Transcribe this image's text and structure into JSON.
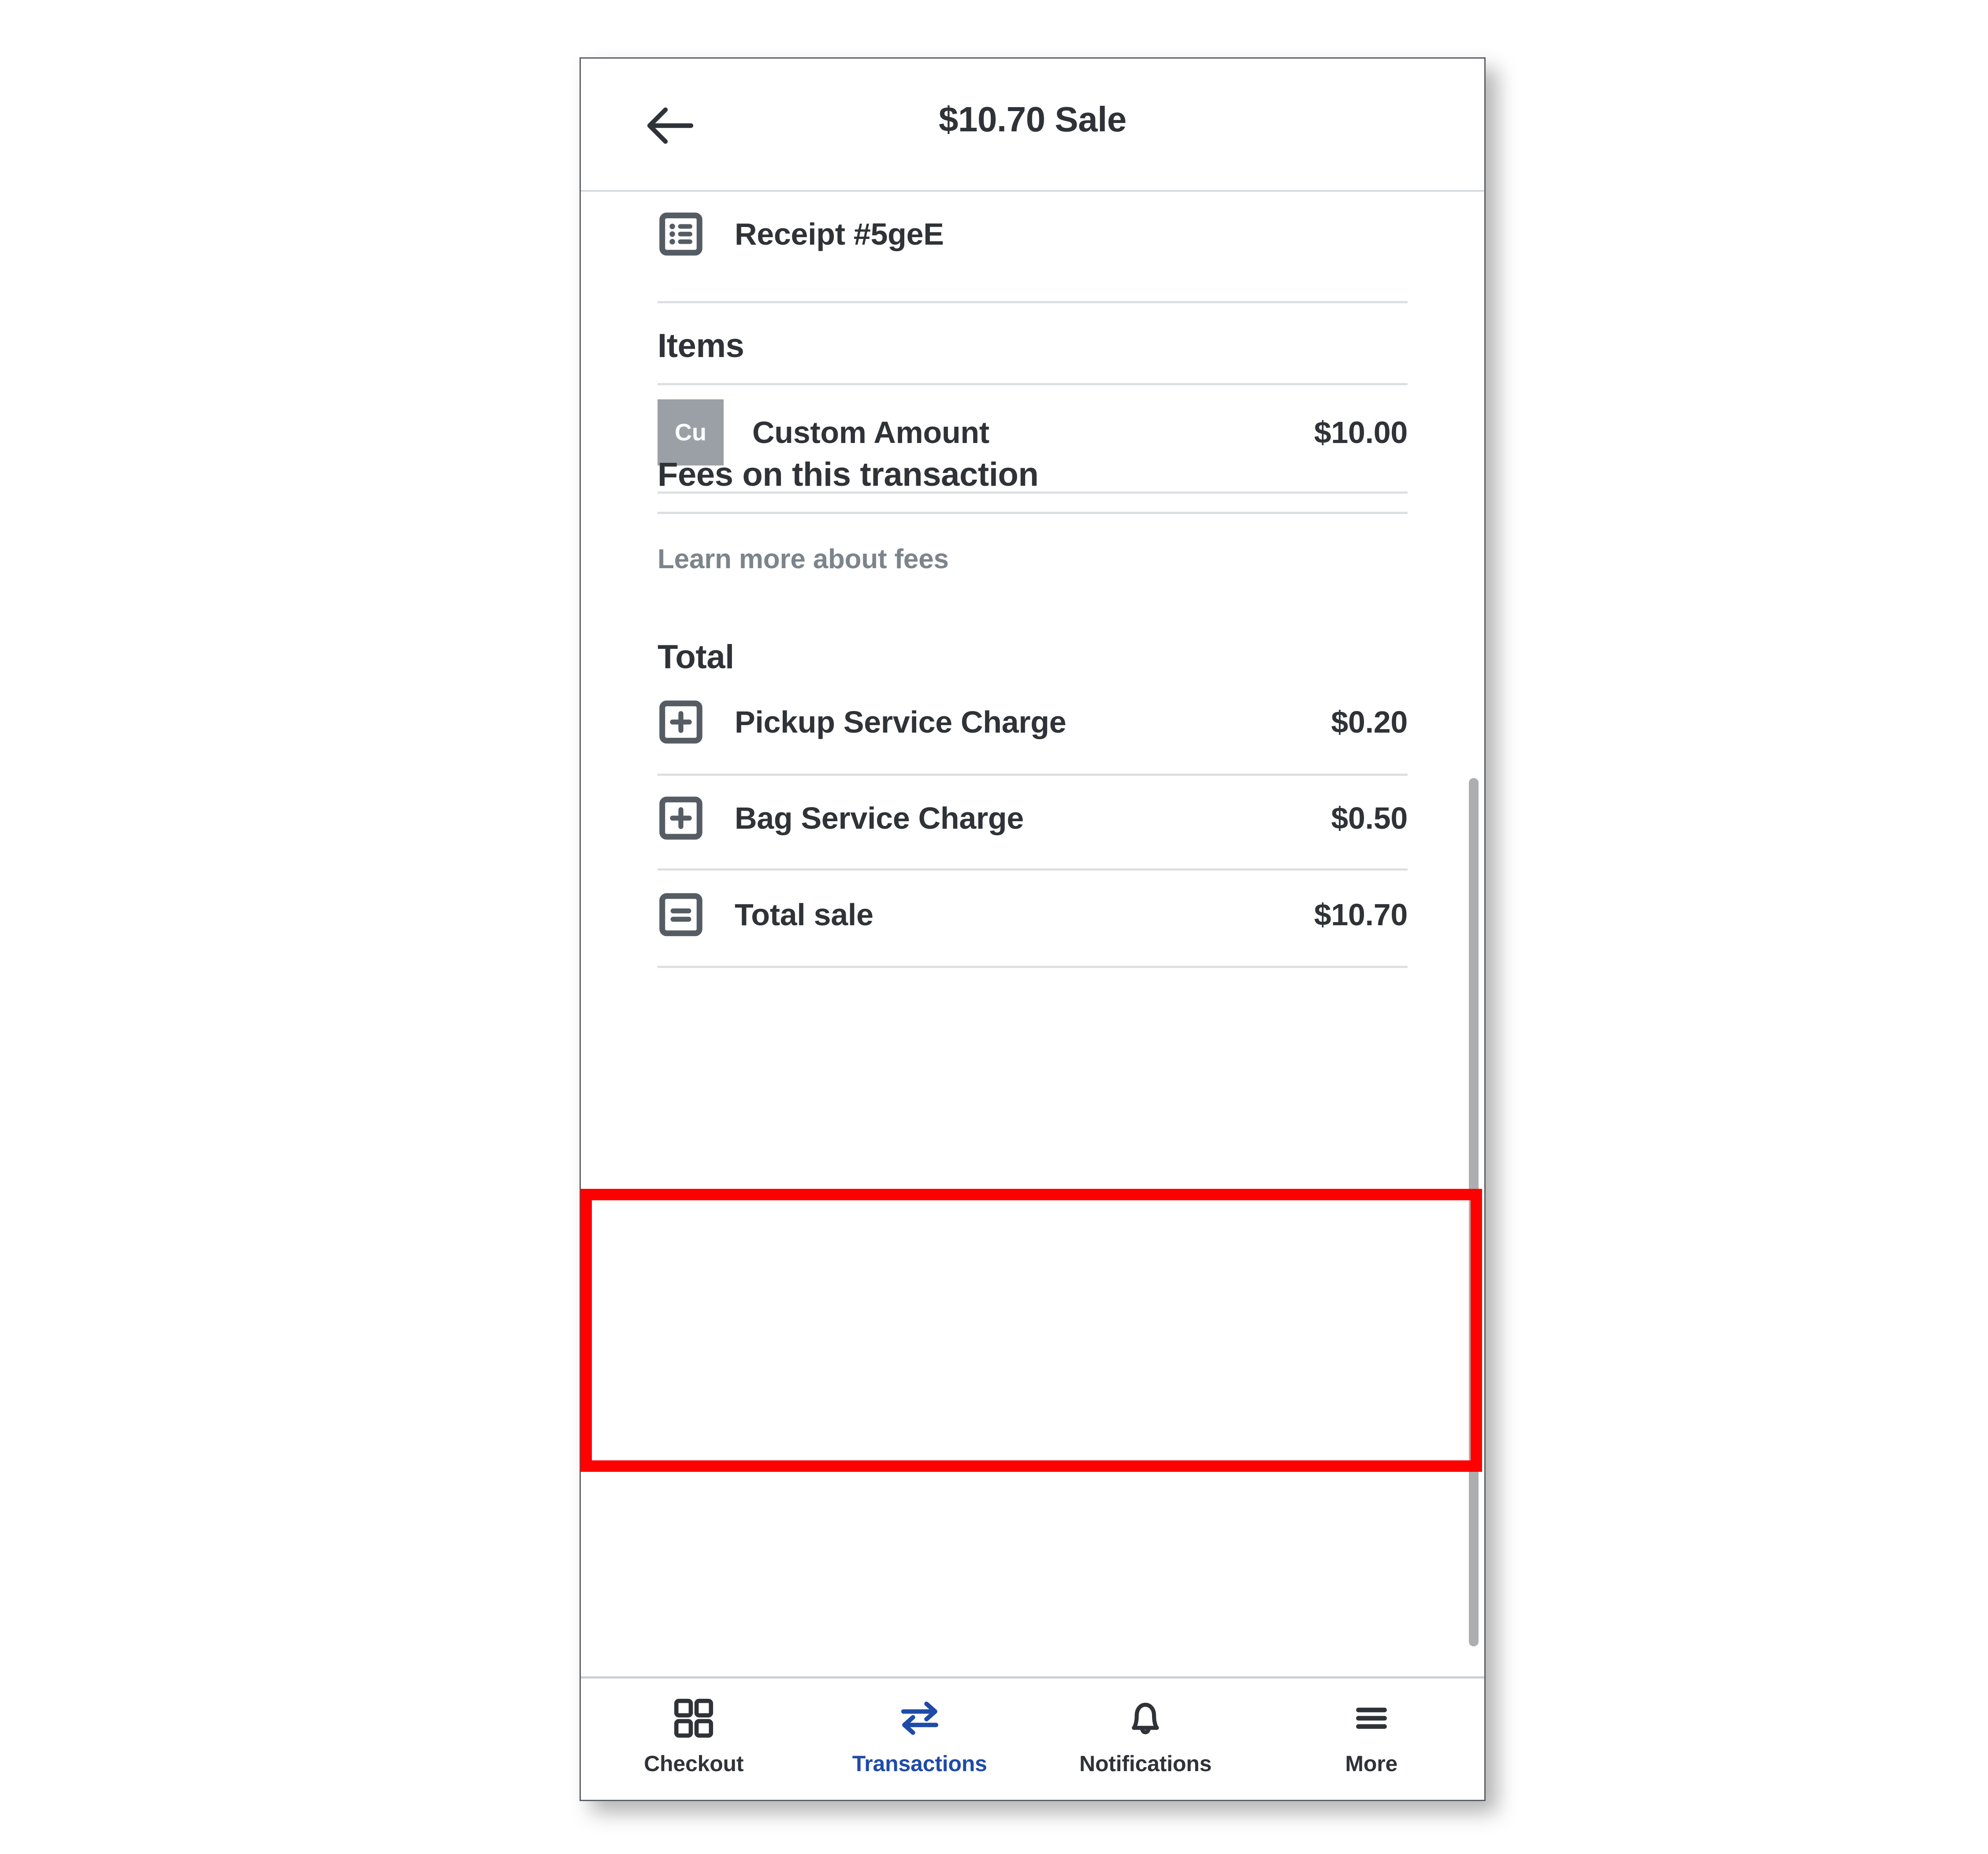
{
  "header": {
    "title": "$10.70 Sale",
    "back_icon": "arrow-left-icon"
  },
  "receipt": {
    "label": "Receipt #5geE",
    "icon": "receipt-list-icon"
  },
  "items_section": {
    "title": "Items",
    "rows": [
      {
        "badge": "Cu",
        "label": "Custom Amount",
        "amount": "$10.00",
        "icon": "custom-amount-tile"
      }
    ]
  },
  "fees_section": {
    "title": "Fees on this transaction",
    "learn_more": "Learn more about fees"
  },
  "total_section": {
    "title": "Total",
    "rows": [
      {
        "label": "Pickup Service Charge",
        "amount": "$0.20",
        "icon": "plus-square-icon",
        "highlighted": true
      },
      {
        "label": "Bag Service Charge",
        "amount": "$0.50",
        "icon": "plus-square-icon",
        "highlighted": true
      },
      {
        "label": "Total sale",
        "amount": "$10.70",
        "icon": "equals-square-icon",
        "highlighted": false
      }
    ]
  },
  "bottom_nav": {
    "items": [
      {
        "label": "Checkout",
        "icon": "grid-squares-icon",
        "active": false
      },
      {
        "label": "Transactions",
        "icon": "transfer-arrows-icon",
        "active": true
      },
      {
        "label": "Notifications",
        "icon": "bell-icon",
        "active": false
      },
      {
        "label": "More",
        "icon": "hamburger-menu-icon",
        "active": false
      }
    ]
  },
  "colors": {
    "text": "#2f3338",
    "muted": "#7c848c",
    "accent": "#1f4ba8",
    "divider": "#dcdfe2",
    "tile": "#9aa0a6",
    "highlight": "#ff0000"
  }
}
